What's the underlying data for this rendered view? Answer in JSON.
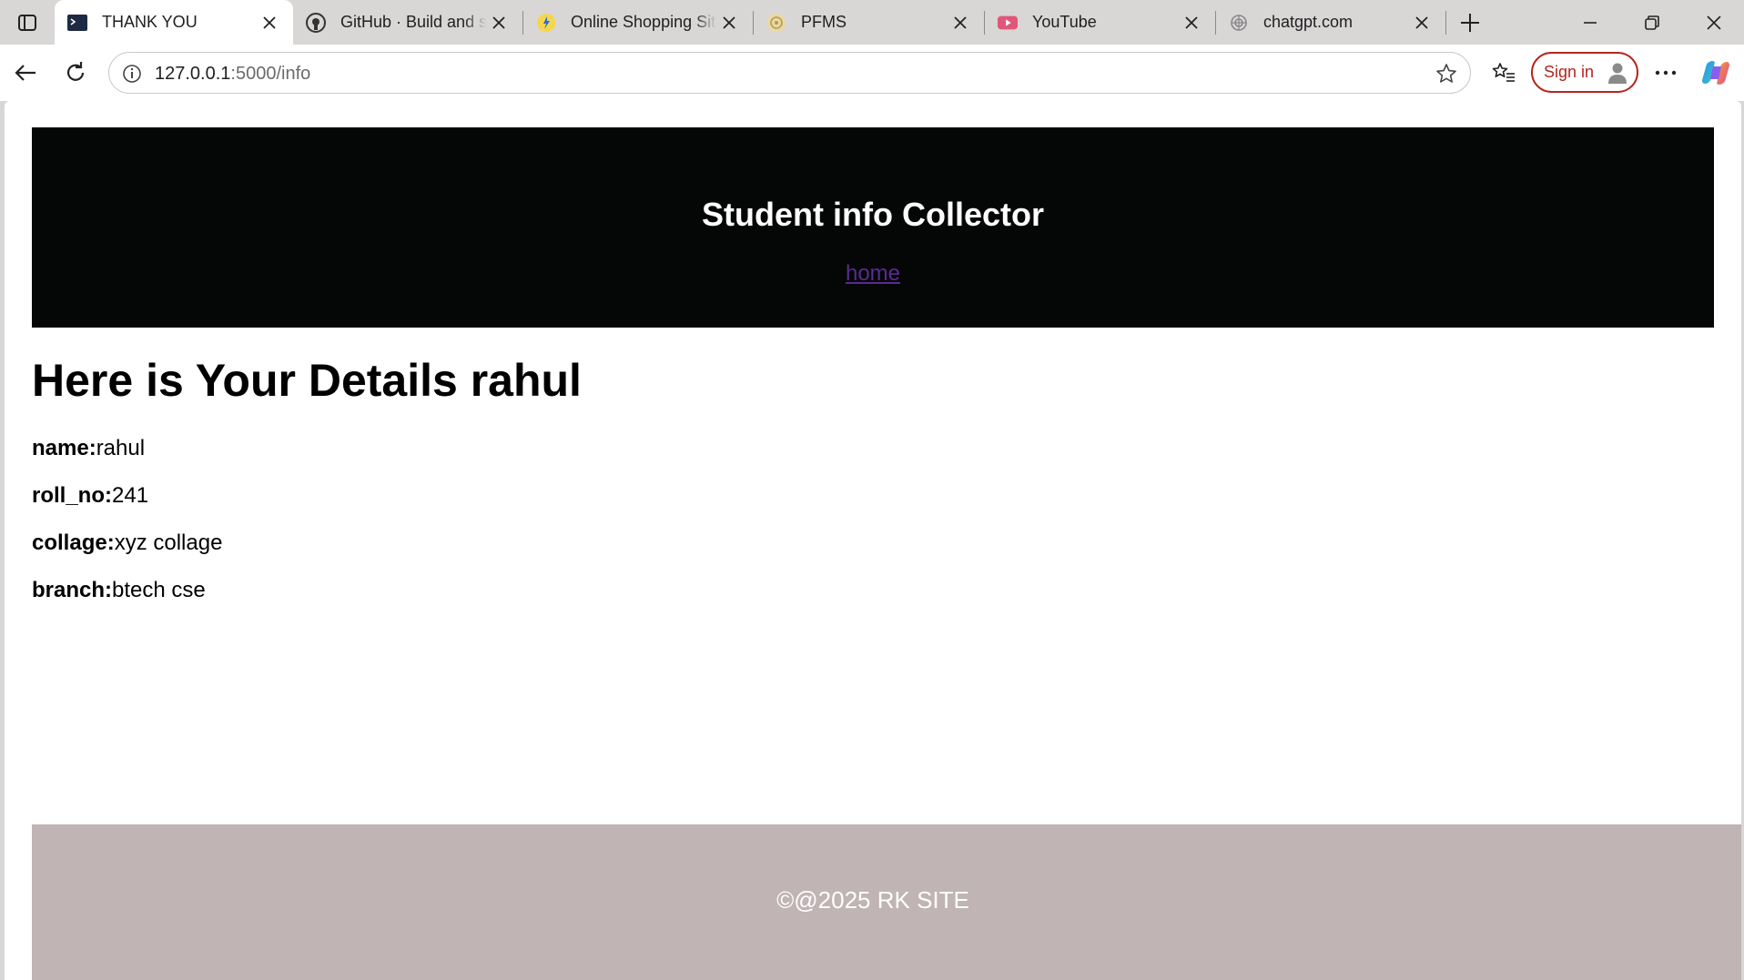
{
  "browser": {
    "tabs": [
      {
        "title": "THANK YOU",
        "icon": "terminal-app-icon",
        "active": true
      },
      {
        "title": "GitHub · Build and ship software",
        "icon": "github-icon",
        "active": false
      },
      {
        "title": "Online Shopping Site",
        "icon": "flipkart-icon",
        "active": false
      },
      {
        "title": "PFMS",
        "icon": "pfms-emblem-icon",
        "active": false
      },
      {
        "title": "YouTube",
        "icon": "youtube-icon",
        "active": false
      },
      {
        "title": "chatgpt.com",
        "icon": "openai-icon",
        "active": false
      }
    ],
    "url_host": "127.0.0.1",
    "url_rest": ":5000/info",
    "signin_label": "Sign in"
  },
  "page": {
    "header_title": "Student info Collector",
    "home_link": "home",
    "details_heading": "Here is Your Details rahul",
    "fields": [
      {
        "key": "name:",
        "value": "rahul"
      },
      {
        "key": "roll_no:",
        "value": "241"
      },
      {
        "key": "collage:",
        "value": "xyz collage"
      },
      {
        "key": "branch:",
        "value": "btech cse"
      }
    ],
    "footer_text": "©@2025 RK SITE"
  },
  "colors": {
    "header_bg": "#050606",
    "footer_bg": "#c0b4b4",
    "link": "#5a2a92",
    "signin_accent": "#b3261e"
  }
}
